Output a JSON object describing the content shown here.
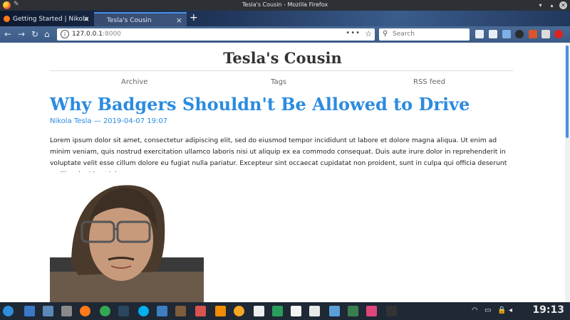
{
  "window": {
    "title": "Tesla's Cousin - Mozilla Firefox"
  },
  "tabs": [
    {
      "label": "Getting Started | Nikola",
      "active": false
    },
    {
      "label": "Tesla's Cousin",
      "active": true
    }
  ],
  "navbar": {
    "url_host": "127.0.0.1",
    "url_port": ":8000",
    "search_placeholder": "Search"
  },
  "site": {
    "title": "Tesla's Cousin",
    "menu": [
      "Archive",
      "Tags",
      "RSS feed"
    ]
  },
  "post": {
    "title": "Why Badgers Shouldn't Be Allowed to Drive",
    "author": "Nikola Tesla",
    "separator": " — ",
    "date": "2019-04-07 19:07",
    "body": "Lorem ipsum dolor sit amet, consectetur adipiscing elit, sed do eiusmod tempor incididunt ut labore et dolore magna aliqua. Ut enim ad minim veniam, quis nostrud exercitation ullamco laboris nisi ut aliquip ex ea commodo consequat. Duis aute irure dolor in reprehenderit in voluptate velit esse cillum dolore eu fugiat nulla pariatur. Excepteur sint occaecat cupidatat non proident, sunt in culpa qui officia deserunt mollit anim id est laborum."
  },
  "taskbar": {
    "clock": "19:13"
  },
  "colors": {
    "link": "#2b8be0",
    "taskbar": "#1f2835",
    "titlebar": "#2d3136"
  }
}
